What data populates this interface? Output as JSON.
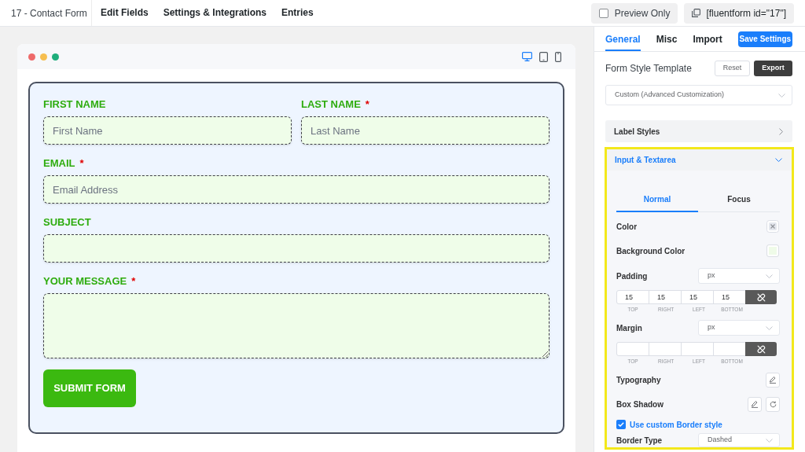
{
  "top_bar": {
    "form_title": "17 - Contact Form",
    "nav": [
      {
        "label": "Edit Fields",
        "selected": false
      },
      {
        "label": "Settings & Integrations",
        "selected": false
      },
      {
        "label": "Entries",
        "selected": false
      }
    ],
    "preview_toggle": {
      "label": "Preview Only",
      "checked": false
    },
    "shortcode": "[fluentform id=\"17\"]"
  },
  "preview": {
    "window_dots": [
      {
        "color": "#ee6a6a"
      },
      {
        "color": "#f6be4f"
      },
      {
        "color": "#1eae7b"
      }
    ],
    "devices": [
      {
        "kind": "desktop",
        "selected": true
      },
      {
        "kind": "tablet",
        "selected": false
      },
      {
        "kind": "mobile",
        "selected": false
      }
    ],
    "form": {
      "rows": [
        {
          "fields": [
            {
              "label": "FIRST NAME",
              "kind": "input",
              "placeholder": "First Name"
            },
            {
              "label": "LAST NAME",
              "required_mark": "*",
              "kind": "input",
              "placeholder": "Last Name"
            }
          ]
        },
        {
          "fields": [
            {
              "label": "EMAIL",
              "required_mark": "*",
              "kind": "input",
              "placeholder": "Email Address"
            }
          ]
        },
        {
          "fields": [
            {
              "label": "SUBJECT",
              "kind": "input"
            }
          ]
        },
        {
          "fields": [
            {
              "label": "YOUR MESSAGE",
              "required_mark": "*",
              "kind": "textarea"
            }
          ]
        }
      ],
      "submit_button": "SUBMIT FORM"
    }
  },
  "settings": {
    "tabs": [
      {
        "label": "General",
        "selected": true
      },
      {
        "label": "Misc",
        "selected": false
      },
      {
        "label": "Import",
        "selected": false
      }
    ],
    "save_button": "Save Settings",
    "template": {
      "label": "Form Style Template",
      "reset_button": "Reset",
      "export_button": "Export",
      "value": "Custom (Advanced Customization)"
    },
    "sections": [
      {
        "title": "Label Styles",
        "expanded": false,
        "highlighted": false
      },
      {
        "title": "Input & Textarea",
        "expanded": true,
        "highlighted": true,
        "tabs": [
          {
            "label": "Normal",
            "selected": true
          },
          {
            "label": "Focus",
            "selected": false
          }
        ],
        "rows": [
          {
            "kind": "color",
            "label": "Color"
          },
          {
            "kind": "color",
            "label": "Background Color",
            "color": "#effbe8"
          },
          {
            "kind": "spacing",
            "label": "Padding",
            "unit": "px",
            "inputs": [
              {
                "value": "15",
                "caption": "TOP"
              },
              {
                "value": "15",
                "caption": "RIGHT"
              },
              {
                "value": "15",
                "caption": "LEFT"
              },
              {
                "value": "15",
                "caption": "BOTTOM"
              }
            ]
          },
          {
            "kind": "spacing",
            "label": "Margin",
            "unit": "px",
            "inputs": [
              {
                "caption": "TOP"
              },
              {
                "caption": "RIGHT"
              },
              {
                "caption": "LEFT"
              },
              {
                "caption": "BOTTOM"
              }
            ]
          },
          {
            "kind": "edit",
            "label": "Typography"
          },
          {
            "kind": "edit_reset",
            "label": "Box Shadow"
          },
          {
            "kind": "checkbox",
            "label": "Use custom Border style",
            "checked": true
          },
          {
            "kind": "select",
            "label": "Border Type",
            "value": "Dashed"
          }
        ]
      }
    ]
  }
}
